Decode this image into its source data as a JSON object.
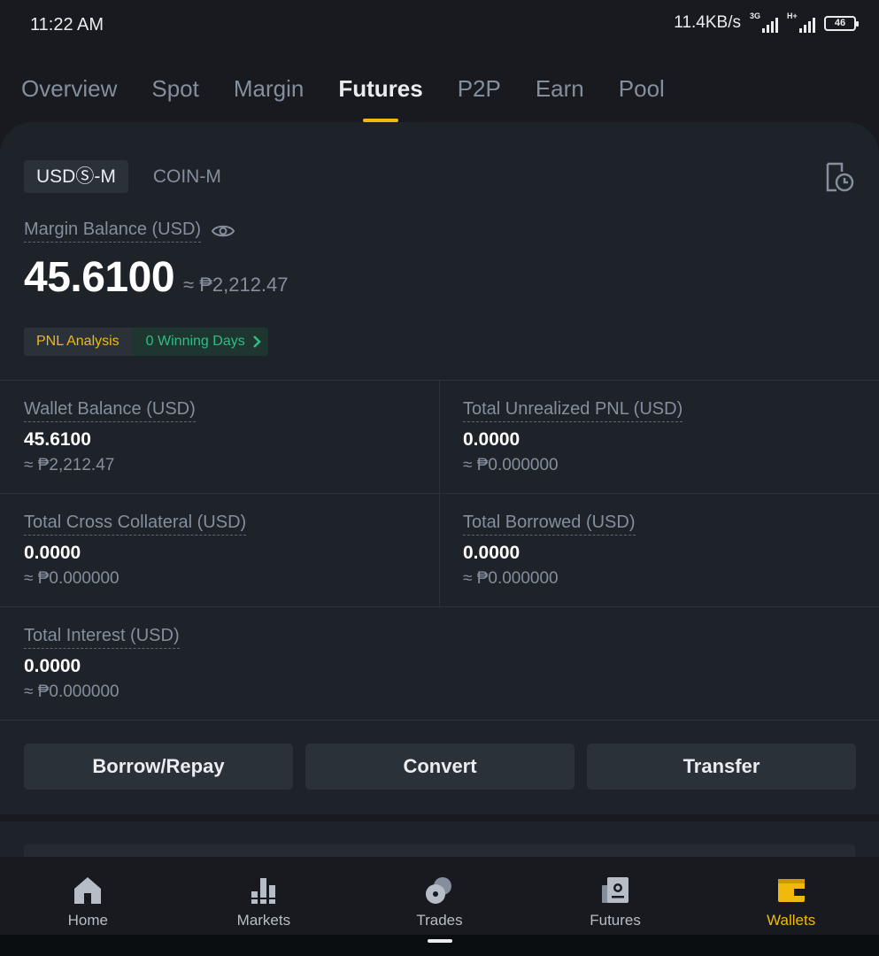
{
  "status": {
    "time": "11:22 AM",
    "net_speed": "11.4KB/s",
    "net_type_1": "3G",
    "net_type_2": "H+",
    "battery": "46"
  },
  "tabs": [
    {
      "label": "Overview"
    },
    {
      "label": "Spot"
    },
    {
      "label": "Margin"
    },
    {
      "label": "Futures"
    },
    {
      "label": "P2P"
    },
    {
      "label": "Earn"
    },
    {
      "label": "Pool"
    }
  ],
  "segment": {
    "usdm": "USDⓈ-M",
    "coinm": "COIN-M"
  },
  "margin_balance": {
    "label": "Margin Balance (USD)",
    "value": "45.6100",
    "approx": "≈ ₱2,212.47"
  },
  "pnl": {
    "analysis": "PNL Analysis",
    "winning": "0 Winning Days"
  },
  "metrics": [
    {
      "label": "Wallet Balance (USD)",
      "value": "45.6100",
      "sub": "≈ ₱2,212.47"
    },
    {
      "label": "Total Unrealized PNL (USD)",
      "value": "0.0000",
      "sub": "≈ ₱0.000000"
    },
    {
      "label": "Total Cross Collateral (USD)",
      "value": "0.0000",
      "sub": "≈ ₱0.000000"
    },
    {
      "label": "Total Borrowed (USD)",
      "value": "0.0000",
      "sub": "≈ ₱0.000000"
    },
    {
      "label": "Total Interest (USD)",
      "value": "0.0000",
      "sub": "≈ ₱0.000000"
    }
  ],
  "actions": {
    "borrow": "Borrow/Repay",
    "convert": "Convert",
    "transfer": "Transfer"
  },
  "nav": [
    {
      "label": "Home",
      "icon": "home-icon"
    },
    {
      "label": "Markets",
      "icon": "markets-icon"
    },
    {
      "label": "Trades",
      "icon": "trades-icon"
    },
    {
      "label": "Futures",
      "icon": "futures-icon"
    },
    {
      "label": "Wallets",
      "icon": "wallet-icon"
    }
  ],
  "colors": {
    "accent": "#f0b90b",
    "positive": "#2ebd85",
    "background": "#181a20",
    "card": "#1e2329"
  }
}
